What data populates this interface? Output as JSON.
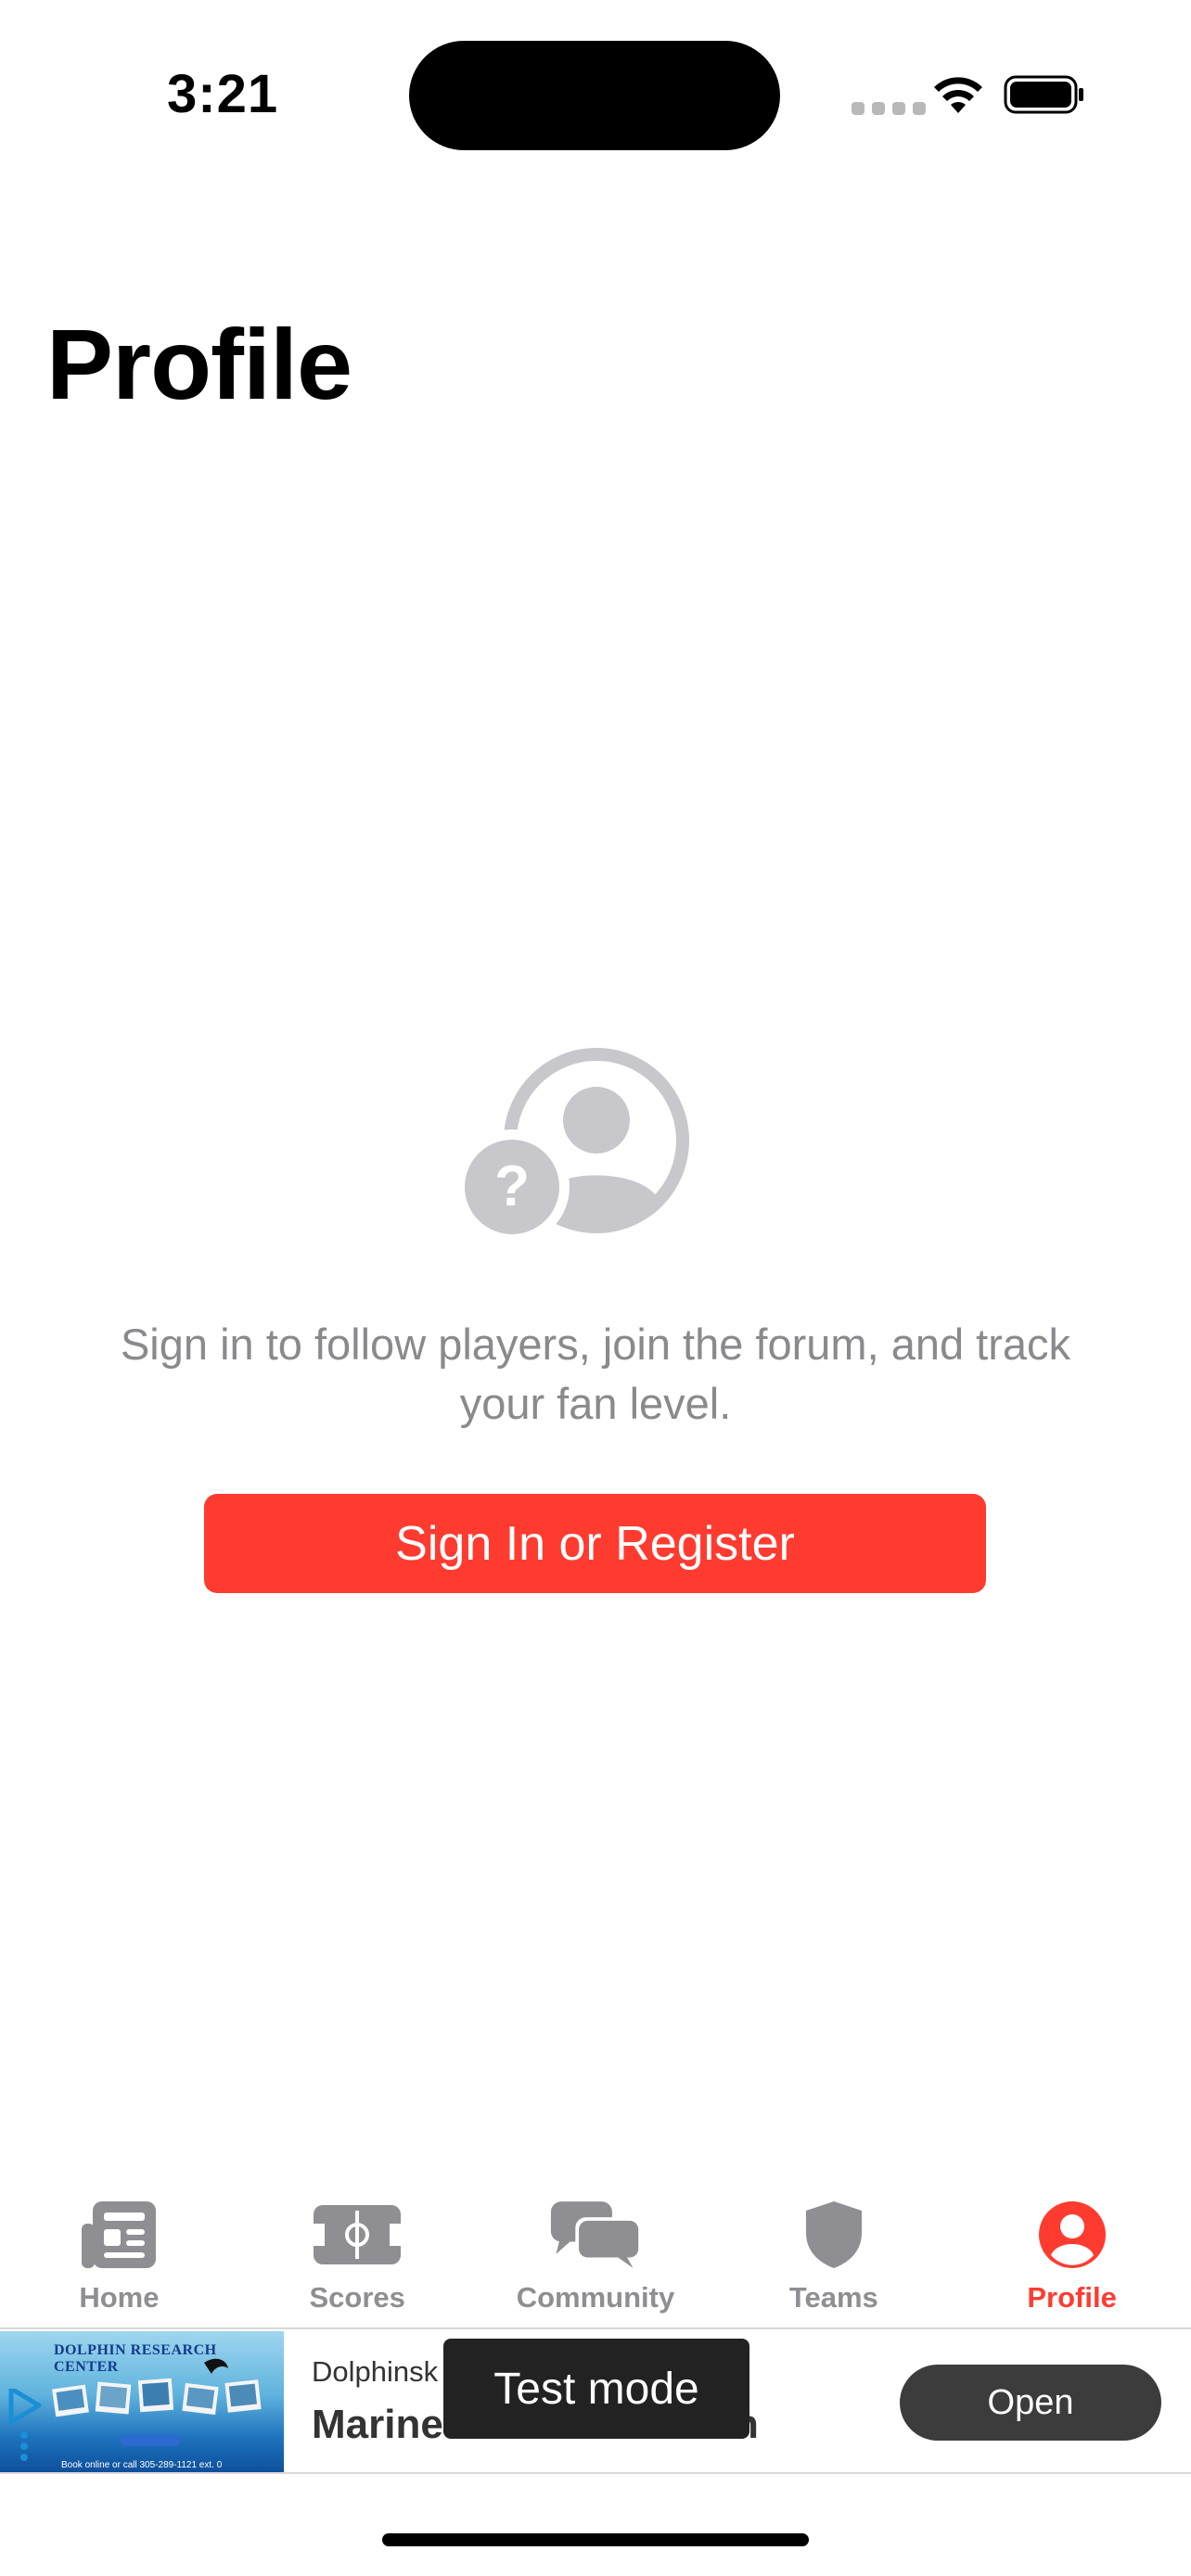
{
  "status_bar": {
    "time": "3:21"
  },
  "header": {
    "title": "Profile"
  },
  "empty_state": {
    "icon": "person-question-icon",
    "message": "Sign in to follow players, join the forum, and track your fan level.",
    "button_label": "Sign In or Register"
  },
  "tab_bar": {
    "active": "Profile",
    "active_color": "#ff3b30",
    "items": [
      {
        "label": "Home",
        "icon": "newspaper-icon"
      },
      {
        "label": "Scores",
        "icon": "field-icon"
      },
      {
        "label": "Community",
        "icon": "chat-bubbles-icon"
      },
      {
        "label": "Teams",
        "icon": "shield-icon"
      },
      {
        "label": "Profile",
        "icon": "person-icon"
      }
    ]
  },
  "ad": {
    "image_text": "DOLPHIN RESEARCH CENTER",
    "image_footer": "Book online or call 305-289-1121 ext. 0",
    "advertiser": "Dolphinsk",
    "headline": "Marine",
    "headline_end": "ation",
    "button_label": "Open",
    "overlay": "Test mode"
  }
}
